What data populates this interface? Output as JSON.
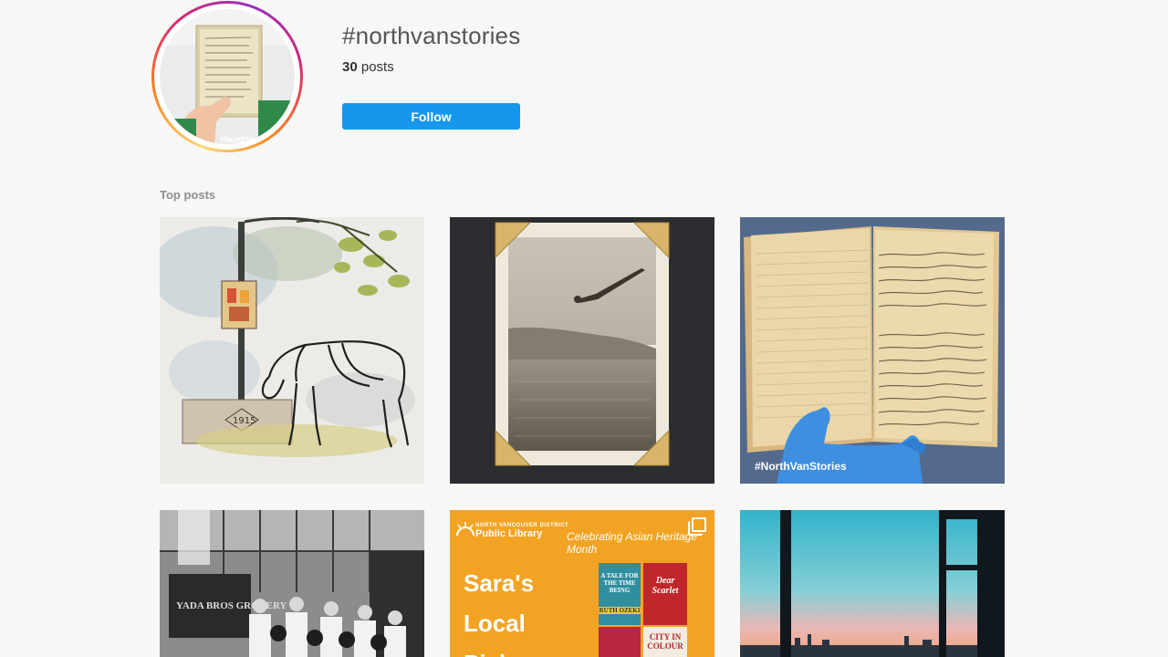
{
  "header": {
    "hashtag": "#northvanstories",
    "post_count": "30",
    "post_count_label": "posts",
    "follow_label": "Follow",
    "avatar_caption": "#NorthVan"
  },
  "sections": {
    "top_posts_label": "Top posts"
  },
  "posts": [
    {
      "id": "watercolor-horse",
      "caption": "",
      "year_text": "1915"
    },
    {
      "id": "vintage-diver-photo",
      "caption": ""
    },
    {
      "id": "handwritten-journal",
      "caption": "#NorthVanStories"
    },
    {
      "id": "yada-bros-grocery",
      "caption": "",
      "sign_text": "YADA BROS GROCERY"
    },
    {
      "id": "library-picks",
      "library_small": "NORTH VANCOUVER DISTRICT",
      "library_name": "Public Library",
      "month_text": "Celebrating Asian Heritage Month",
      "title_lines": [
        "Sara's",
        "Local",
        "Picks"
      ],
      "books": [
        "A TALE FOR THE TIME BEING",
        "RUTH OZEKI",
        "Dear Scarlet",
        "CITY IN COLOUR"
      ]
    },
    {
      "id": "sunset-window",
      "caption": ""
    }
  ],
  "colors": {
    "follow_blue": "#1597ee",
    "library_orange": "#f2a324"
  }
}
